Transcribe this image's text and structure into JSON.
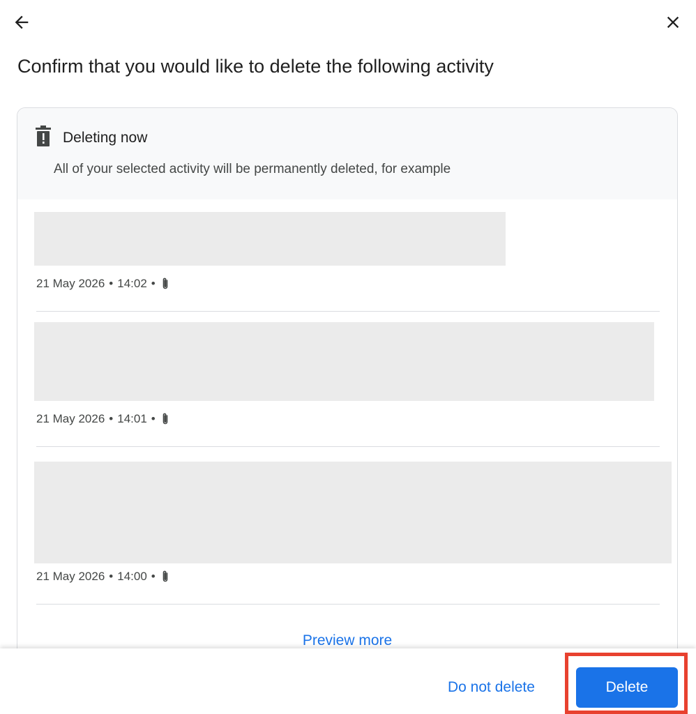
{
  "header": {
    "back_icon": "arrow-back-icon",
    "close_icon": "close-icon"
  },
  "title": "Confirm that you would like to delete the following activity",
  "card": {
    "header_icon": "trash-warning-icon",
    "header_title": "Deleting now",
    "header_description": "All of your selected activity will be permanently deleted, for example",
    "entries": [
      {
        "date": "21 May 2026",
        "time": "14:02",
        "separator": "•",
        "attachment_icon": "paperclip-icon"
      },
      {
        "date": "21 May 2026",
        "time": "14:01",
        "separator": "•",
        "attachment_icon": "paperclip-icon"
      },
      {
        "date": "21 May 2026",
        "time": "14:00",
        "separator": "•",
        "attachment_icon": "paperclip-icon"
      }
    ],
    "preview_more_label": "Preview more"
  },
  "footer": {
    "do_not_delete_label": "Do not delete",
    "delete_label": "Delete"
  },
  "colors": {
    "accent": "#1a73e8",
    "highlight": "#e8412f",
    "placeholder": "#ebebeb"
  }
}
